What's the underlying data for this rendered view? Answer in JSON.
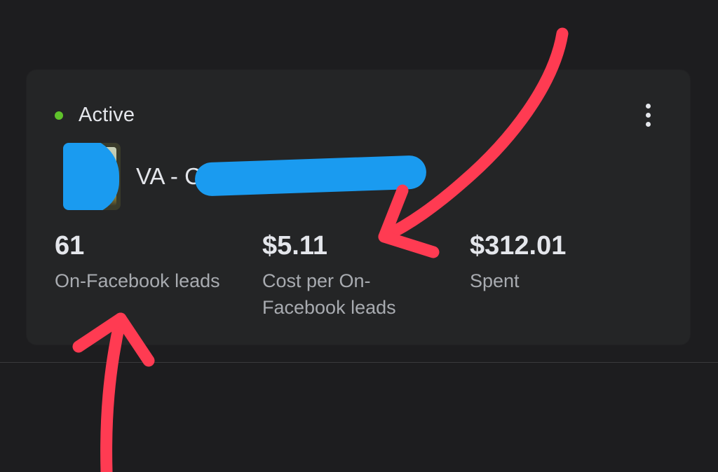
{
  "colors": {
    "status_active": "#5fc22b",
    "annotation_arrow": "#ff3b52",
    "redaction": "#1a9bf0"
  },
  "card": {
    "status_label": "Active",
    "more_icon": "more-vertical-icon",
    "campaign_name_visible": "VA - C",
    "metrics": [
      {
        "value": "61",
        "label": "On-Facebook leads"
      },
      {
        "value": "$5.11",
        "label": "Cost per On-Facebook leads"
      },
      {
        "value": "$312.01",
        "label": "Spent"
      }
    ]
  }
}
